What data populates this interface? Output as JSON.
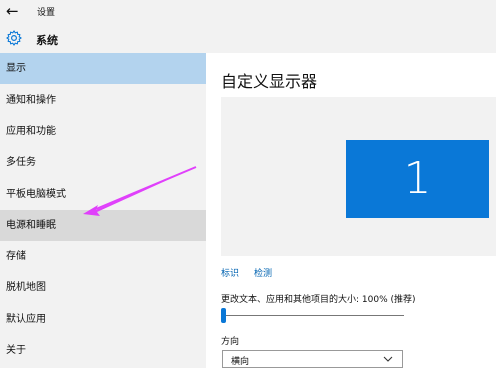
{
  "window": {
    "back_icon": "←",
    "title": "设置"
  },
  "header": {
    "title": "系统",
    "icon": "gear-icon"
  },
  "sidebar": {
    "items": [
      {
        "label": "显示"
      },
      {
        "label": "通知和操作"
      },
      {
        "label": "应用和功能"
      },
      {
        "label": "多任务"
      },
      {
        "label": "平板电脑模式"
      },
      {
        "label": "电源和睡眠"
      },
      {
        "label": "存储"
      },
      {
        "label": "脱机地图"
      },
      {
        "label": "默认应用"
      },
      {
        "label": "关于"
      }
    ],
    "selected": "显示",
    "highlighted": "电源和睡眠"
  },
  "main": {
    "title": "自定义显示器",
    "monitor_label": "1",
    "links": {
      "identify": "标识",
      "detect": "检测"
    },
    "scale": {
      "label": "更改文本、应用和其他项目的大小: 100% (推荐)",
      "value_percent": 0
    },
    "orientation": {
      "label": "方向",
      "value": "横向"
    }
  },
  "colors": {
    "accent": "#0a78d7",
    "selected_bg": "#b3d3ee",
    "annotation": "#e040fb"
  }
}
